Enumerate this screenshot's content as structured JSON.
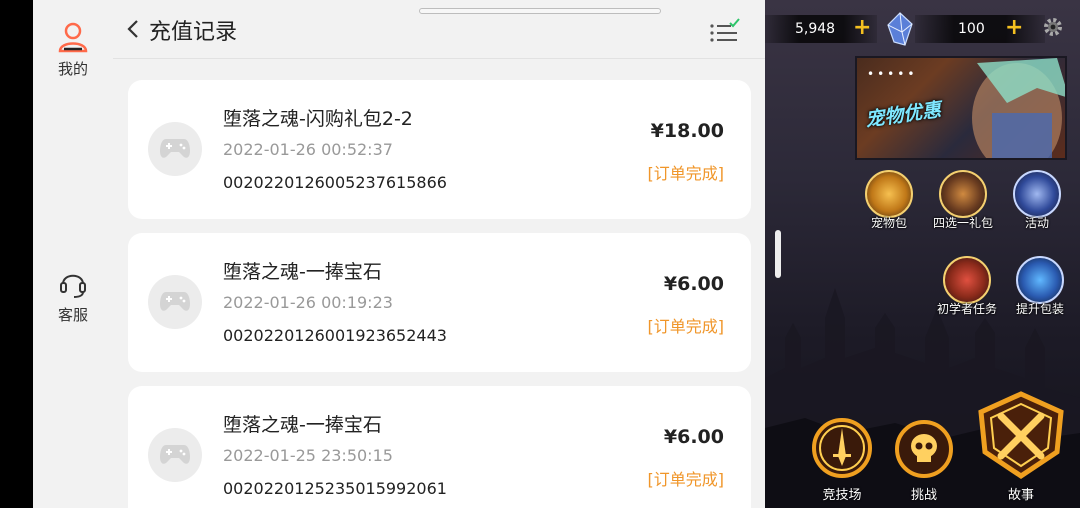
{
  "sidebar": {
    "items": [
      {
        "label": "我的",
        "icon": "user-icon"
      },
      {
        "label": "客服",
        "icon": "headset-icon"
      }
    ]
  },
  "header": {
    "title": "充值记录",
    "back_icon": "chevron-left-icon",
    "filter_icon": "list-check-icon"
  },
  "records": [
    {
      "name": "堕落之魂-闪购礼包2-2",
      "time": "2022-01-26 00:52:37",
      "order": "002022012600523761586​6",
      "price": "¥18.00",
      "status": "[订单完成]"
    },
    {
      "name": "堕落之魂-一捧宝石",
      "time": "2022-01-26 00:19:23",
      "order": "002022012600192365244​3",
      "price": "¥6.00",
      "status": "[订单完成]"
    },
    {
      "name": "堕落之魂-一捧宝石",
      "time": "2022-01-25 23:50:15",
      "order": "002022012523501599206​1",
      "price": "¥6.00",
      "status": "[订单完成]"
    }
  ],
  "game": {
    "gold": "5,948",
    "gems": "100",
    "banner_title": "宠物优惠",
    "banner_dots": "•••••",
    "icons": [
      {
        "label": "宠物包"
      },
      {
        "label": "四选一礼包"
      },
      {
        "label": "活动"
      },
      {
        "label": "初学者任务"
      },
      {
        "label": "提升包装"
      }
    ],
    "bottom": [
      {
        "label": "竞技场"
      },
      {
        "label": "挑战"
      },
      {
        "label": "故事"
      }
    ]
  },
  "colors": {
    "accent_status": "#f0962a",
    "gold_plus": "#f4c020"
  }
}
